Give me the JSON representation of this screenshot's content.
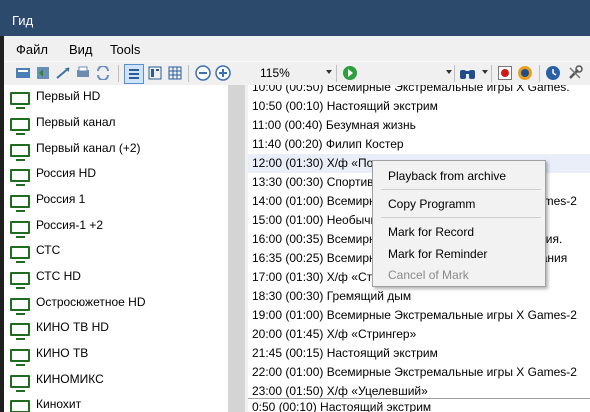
{
  "window": {
    "title": "Гид"
  },
  "menubar": {
    "file": "Файл",
    "view": "Вид",
    "tools": "Tools"
  },
  "toolbar": {
    "zoom": "115%",
    "channel_select": ""
  },
  "channels": [
    {
      "name": "Первый HD"
    },
    {
      "name": "Первый канал"
    },
    {
      "name": "Первый канал (+2)"
    },
    {
      "name": "Россия HD"
    },
    {
      "name": "Россия 1"
    },
    {
      "name": "Россия-1 +2"
    },
    {
      "name": "СТС"
    },
    {
      "name": "СТС HD"
    },
    {
      "name": "Остросюжетное HD"
    },
    {
      "name": "КИНО ТВ HD"
    },
    {
      "name": "КИНО ТВ"
    },
    {
      "name": "КИНОМИКС"
    },
    {
      "name": "Кинохит"
    }
  ],
  "programs": [
    {
      "text": "10:00  (00:50)  Всемирные Экстремальные игры X Games."
    },
    {
      "text": "10:50  (00:10)  Настоящий экстрим"
    },
    {
      "text": "11:00  (00:40)  Безумная жизнь"
    },
    {
      "text": "11:40  (00:20)  Филип Костер"
    },
    {
      "text": "12:00  (01:30)  Х/ф «Помпеи»"
    },
    {
      "text": "13:30  (00:30)  Спортивный экстрим"
    },
    {
      "text": "14:00  (01:00)  Всемирные Экстремальные игры X Games-2"
    },
    {
      "text": "15:00  (01:00)  Необычные виды спорта"
    },
    {
      "text": "16:00  (00:35)  Всемирные Экстремальные игры. Россия."
    },
    {
      "text": "16:35  (00:25)  Всемирные Экстремальные игры. Испания"
    },
    {
      "text": "17:00  (01:30)  Х/ф «Стрингер»"
    },
    {
      "text": "18:30  (00:30)  Гремящий дым"
    },
    {
      "text": "19:00  (01:00)  Всемирные Экстремальные игры X Games-2"
    },
    {
      "text": "20:00  (01:45)  Х/ф «Стрингер»"
    },
    {
      "text": "21:45  (00:15)  Настоящий экстрим"
    },
    {
      "text": "22:00  (01:00)  Всемирные Экстремальные игры X Games-2"
    },
    {
      "text": "23:00  (01:50)  Х/ф «Уцелевший»"
    }
  ],
  "last_program": "0:50  (00:10)  Настоящий экстрим",
  "context_menu": {
    "playback": "Playback from archive",
    "copy": "Copy Programm",
    "mark_record": "Mark for Record",
    "mark_reminder": "Mark for Reminder",
    "cancel_mark": "Cancel of Mark"
  },
  "colors": {
    "titlebar": "#2c4a6c",
    "tv_icon": "#1f6e1f",
    "selection": "#e9eef8"
  }
}
